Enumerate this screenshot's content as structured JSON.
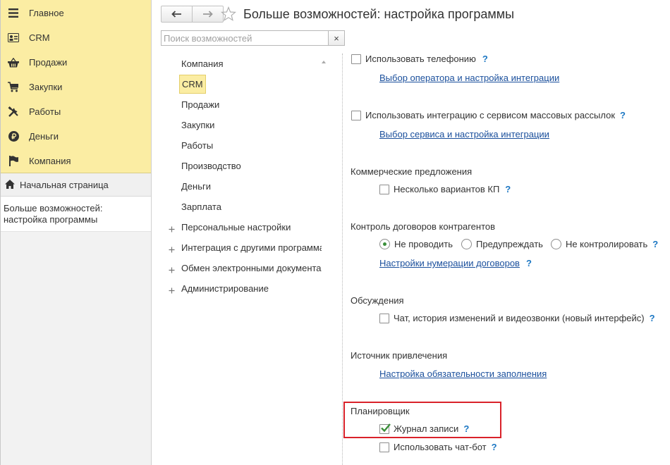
{
  "sections": {
    "items": [
      {
        "label": "Главное",
        "icon": "menu-icon"
      },
      {
        "label": "CRM",
        "icon": "contact-card-icon"
      },
      {
        "label": "Продажи",
        "icon": "basket-icon"
      },
      {
        "label": "Закупки",
        "icon": "cart-icon"
      },
      {
        "label": "Работы",
        "icon": "tools-icon"
      },
      {
        "label": "Деньги",
        "icon": "ruble-icon"
      },
      {
        "label": "Компания",
        "icon": "flag-icon"
      }
    ],
    "home": "Начальная страница",
    "open_page": "Больше возможностей: настройка программы",
    "accent": "#fbeda3"
  },
  "header": {
    "title": "Больше возможностей: настройка программы",
    "back_icon": "arrow-left-icon",
    "forward_icon": "arrow-right-icon",
    "favorite_icon": "star-icon"
  },
  "search": {
    "placeholder": "Поиск возможностей",
    "clear": "×"
  },
  "categories": [
    {
      "label": "Компания",
      "expandable": false,
      "selected": false
    },
    {
      "label": "CRM",
      "expandable": false,
      "selected": true
    },
    {
      "label": "Продажи",
      "expandable": false,
      "selected": false
    },
    {
      "label": "Закупки",
      "expandable": false,
      "selected": false
    },
    {
      "label": "Работы",
      "expandable": false,
      "selected": false
    },
    {
      "label": "Производство",
      "expandable": false,
      "selected": false
    },
    {
      "label": "Деньги",
      "expandable": false,
      "selected": false
    },
    {
      "label": "Зарплата",
      "expandable": false,
      "selected": false
    },
    {
      "label": "Персональные настройки",
      "expandable": true,
      "selected": false
    },
    {
      "label": "Интеграция с другими программами",
      "expandable": true,
      "selected": false
    },
    {
      "label": "Обмен электронными документами",
      "expandable": true,
      "selected": false
    },
    {
      "label": "Администрирование",
      "expandable": true,
      "selected": false
    }
  ],
  "settings": {
    "telephony": {
      "label": "Использовать телефонию",
      "checked": false,
      "help": "?",
      "link": "Выбор оператора и настройка интеграции"
    },
    "mailing": {
      "label": "Использовать интеграцию с сервисом массовых рассылок",
      "checked": false,
      "help": "?",
      "link": "Выбор сервиса и настройка интеграции"
    },
    "offers": {
      "heading": "Коммерческие предложения",
      "option": "Несколько вариантов КП",
      "checked": false,
      "help": "?"
    },
    "contracts": {
      "heading": "Контроль договоров контрагентов",
      "options": [
        "Не проводить",
        "Предупреждать",
        "Не контролировать"
      ],
      "selected": "Не проводить",
      "help": "?",
      "link": "Настройки нумерации договоров",
      "link_help": "?"
    },
    "discussions": {
      "heading": "Обсуждения",
      "option": "Чат, история изменений и видеозвонки (новый интерфейс)",
      "checked": false,
      "help": "?"
    },
    "source": {
      "heading": "Источник привлечения",
      "link": "Настройка обязательности заполнения"
    },
    "scheduler": {
      "heading": "Планировщик",
      "journal": {
        "label": "Журнал записи",
        "checked": true,
        "help": "?"
      },
      "chatbot": {
        "label": "Использовать чат-бот",
        "checked": false,
        "help": "?"
      }
    }
  },
  "colors": {
    "highlight_border": "#d9222a",
    "link": "#1a4f9c",
    "help": "#1c77c3",
    "check": "#3a8f3a"
  }
}
